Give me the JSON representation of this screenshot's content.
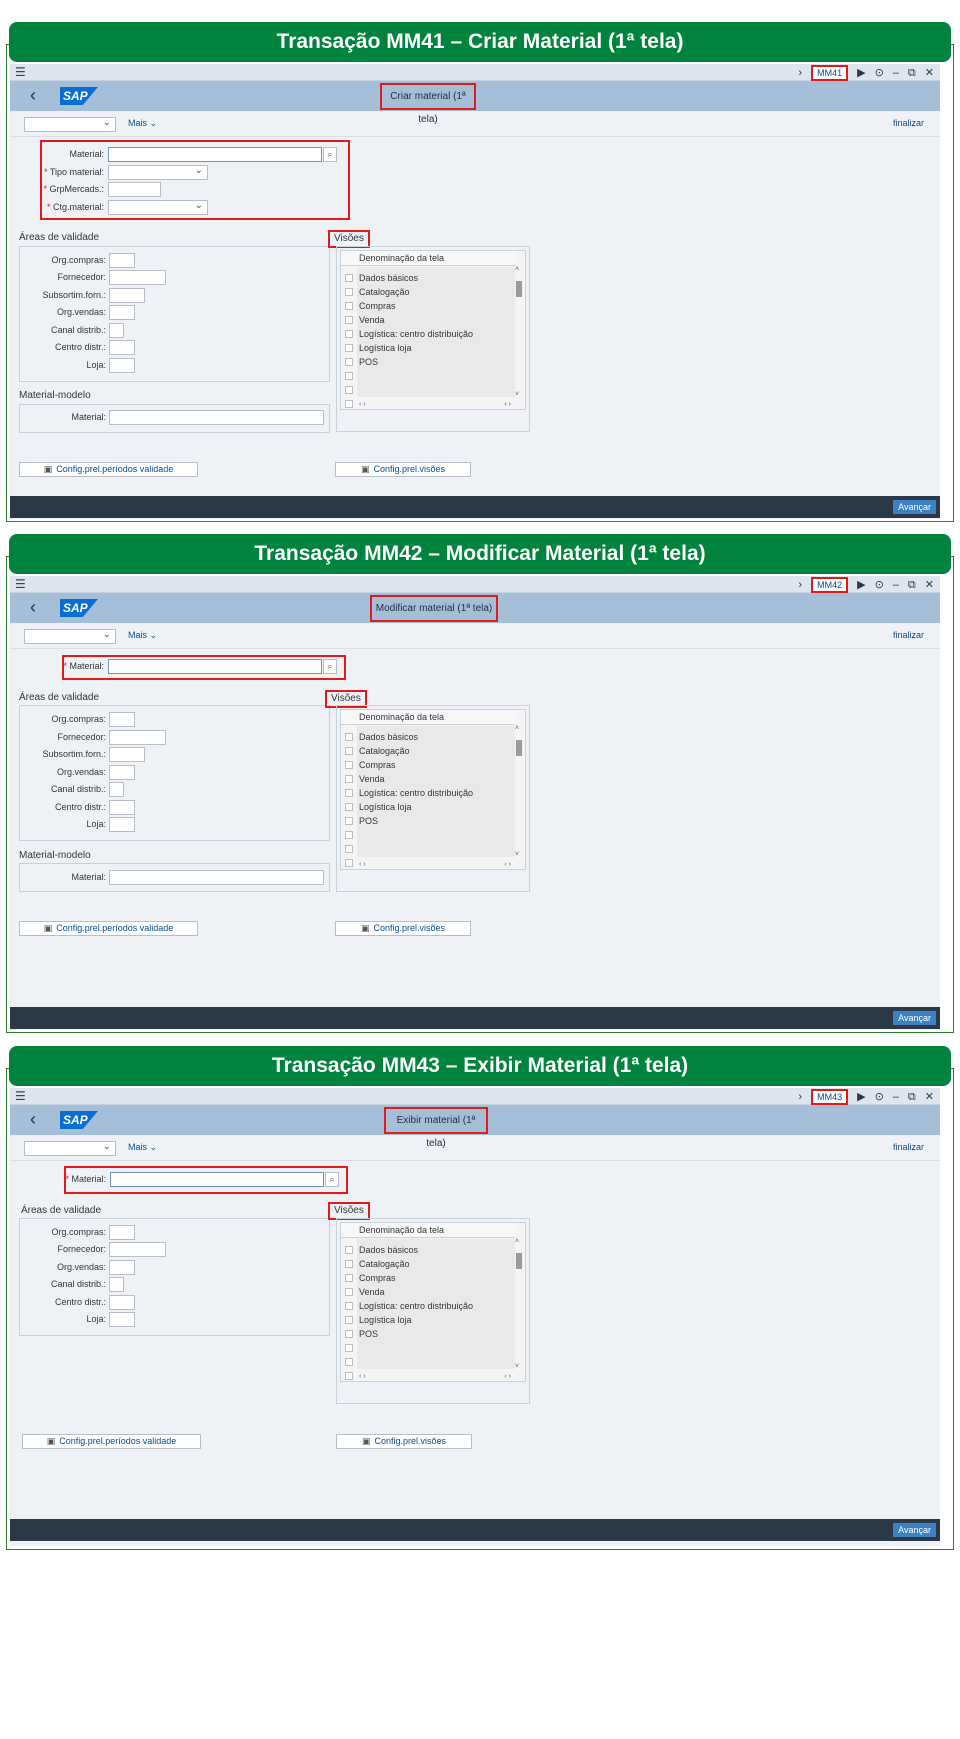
{
  "panels": [
    {
      "banner": "Transação MM41 – Criar Material (1ª tela)",
      "tcode": "MM41",
      "title": "Criar material (1ª tela)",
      "toolbar": {
        "more_label": "Mais",
        "exit_label": "finalizar"
      },
      "header_fields": [
        {
          "label": "Material:",
          "required": false
        },
        {
          "label": "Tipo material:",
          "required": true
        },
        {
          "label": "GrpMercads.:",
          "required": true
        },
        {
          "label": "Ctg.material:",
          "required": true
        }
      ],
      "validity": {
        "title": "Áreas de validade",
        "fields": [
          "Org.compras:",
          "Fornecedor:",
          "Subsortim.forn.:",
          "Org.vendas:",
          "Canal distrib.:",
          "Centro distr.:",
          "Loja:"
        ]
      },
      "model": {
        "title": "Material-modelo",
        "field": "Material:"
      },
      "views": {
        "title": "Visões",
        "column": "Denominação da tela",
        "rows": [
          "Dados básicos",
          "Catalogação",
          "Compras",
          "Venda",
          "Logística: centro distribuição",
          "Logística loja",
          "POS"
        ]
      },
      "buttons": {
        "periods": "Config.prel.períodos validade",
        "views": "Config.prel.visões"
      },
      "footer": {
        "next": "Avançar"
      }
    },
    {
      "banner": "Transação MM42 – Modificar Material (1ª tela)",
      "tcode": "MM42",
      "title": "Modificar material (1ª tela)",
      "toolbar": {
        "more_label": "Mais",
        "exit_label": "finalizar"
      },
      "header_fields": [
        {
          "label": "Material:",
          "required": true
        }
      ],
      "validity": {
        "title": "Áreas de validade",
        "fields": [
          "Org.compras:",
          "Fornecedor:",
          "Subsortim.forn.:",
          "Org.vendas:",
          "Canal distrib.:",
          "Centro distr.:",
          "Loja:"
        ]
      },
      "model": {
        "title": "Material-modelo",
        "field": "Material:"
      },
      "views": {
        "title": "Visões",
        "column": "Denominação da tela",
        "rows": [
          "Dados básicos",
          "Catalogação",
          "Compras",
          "Venda",
          "Logística: centro distribuição",
          "Logística loja",
          "POS"
        ]
      },
      "buttons": {
        "periods": "Config.prel.períodos validade",
        "views": "Config.prel.visões"
      },
      "footer": {
        "next": "Avançar"
      }
    },
    {
      "banner": "Transação MM43 – Exibir Material (1ª tela)",
      "tcode": "MM43",
      "title": "Exibir material (1ª tela)",
      "toolbar": {
        "more_label": "Mais",
        "exit_label": "finalizar"
      },
      "header_fields": [
        {
          "label": "Material:",
          "required": true
        }
      ],
      "validity": {
        "title": "Áreas de validade",
        "fields": [
          "Org.compras:",
          "Fornecedor:",
          "Org.vendas:",
          "Canal distrib.:",
          "Centro distr.:",
          "Loja:"
        ]
      },
      "model": null,
      "views": {
        "title": "Visões",
        "column": "Denominação da tela",
        "rows": [
          "Dados básicos",
          "Catalogação",
          "Compras",
          "Venda",
          "Logística: centro distribuição",
          "Logística loja",
          "POS"
        ]
      },
      "buttons": {
        "periods": "Config.prel.períodos validade",
        "views": "Config.prel.visões"
      },
      "footer": {
        "next": "Avançar"
      }
    }
  ],
  "colors": {
    "banner": "#00843d",
    "highlight": "#e21a1a",
    "shell": "#a6bfd9",
    "footer": "#2b3845",
    "link": "#0a4d8c"
  }
}
